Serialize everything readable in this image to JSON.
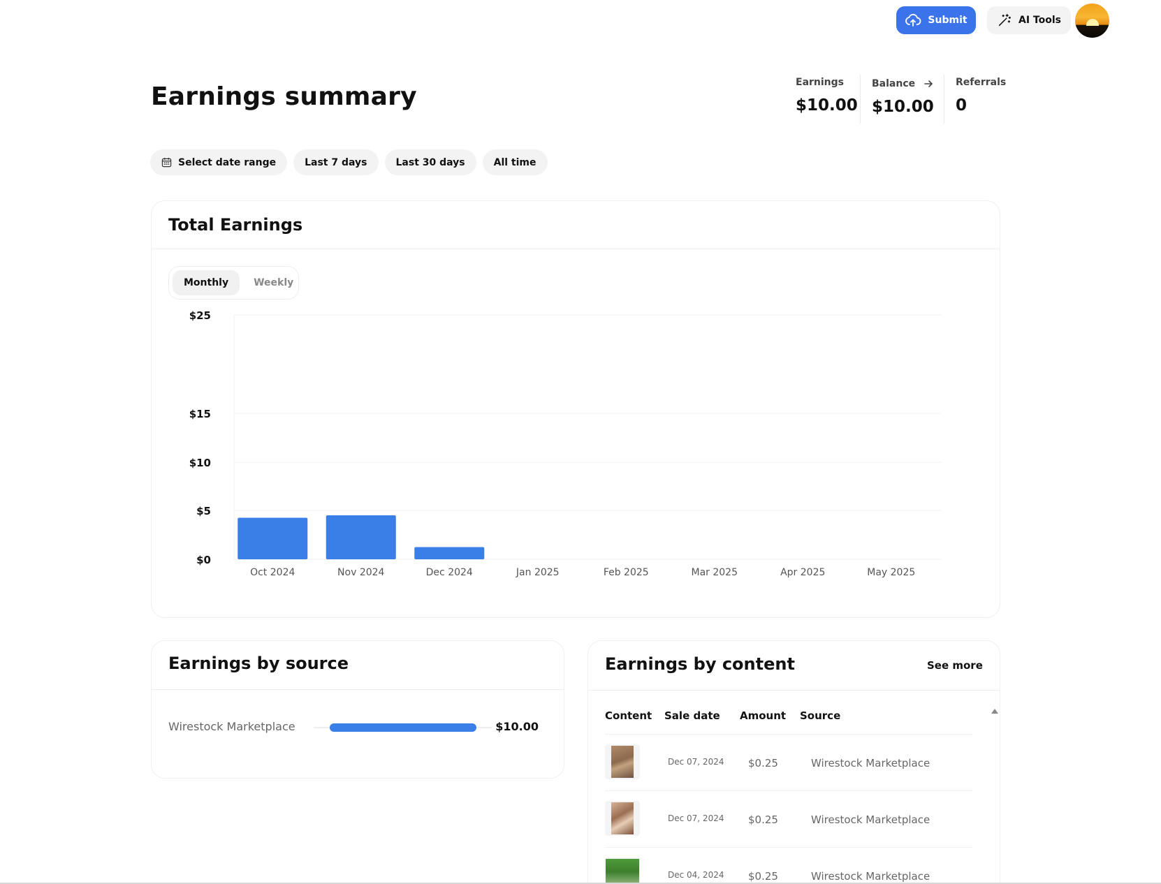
{
  "topbar": {
    "submit_label": "Submit",
    "ai_tools_label": "AI Tools"
  },
  "header": {
    "title": "Earnings summary",
    "stats": {
      "earnings_label": "Earnings",
      "earnings_value": "$10.00",
      "balance_label": "Balance",
      "balance_value": "$10.00",
      "referrals_label": "Referrals",
      "referrals_value": "0"
    }
  },
  "filters": [
    "Select date range",
    "Last 7 days",
    "Last 30 days",
    "All time"
  ],
  "total_earnings": {
    "title": "Total Earnings",
    "toggle": {
      "monthly": "Monthly",
      "weekly": "Weekly",
      "selected": "Monthly"
    }
  },
  "chart_data": {
    "type": "bar",
    "categories": [
      "Oct 2024",
      "Nov 2024",
      "Dec 2024",
      "Jan 2025",
      "Feb 2025",
      "Mar 2025",
      "Apr 2025",
      "May 2025"
    ],
    "values": [
      4.25,
      4.5,
      1.25,
      0,
      0,
      0,
      0,
      0
    ],
    "y_ticks": [
      0,
      5,
      10,
      15,
      25
    ],
    "y_tick_labels": [
      "$0",
      "$5",
      "$10",
      "$15",
      "$25"
    ],
    "ylim": [
      0,
      25
    ],
    "grid": true,
    "bar_color": "#3a7ee8"
  },
  "earnings_by_source": {
    "title": "Earnings by source",
    "rows": [
      {
        "name": "Wirestock Marketplace",
        "amount": "$10.00",
        "share": 1.0
      }
    ]
  },
  "earnings_by_content": {
    "title": "Earnings by content",
    "see_more": "See more",
    "columns": [
      "Content",
      "Sale date",
      "Amount",
      "Source"
    ],
    "rows": [
      {
        "date": "Dec 07, 2024",
        "amount": "$0.25",
        "source": "Wirestock Marketplace"
      },
      {
        "date": "Dec 07, 2024",
        "amount": "$0.25",
        "source": "Wirestock Marketplace"
      },
      {
        "date": "Dec 04, 2024",
        "amount": "$0.25",
        "source": "Wirestock Marketplace"
      }
    ]
  },
  "colors": {
    "accent": "#3a73ea",
    "bar": "#3a7ee8",
    "pill_bg": "#f3f3f3"
  },
  "icons": {
    "submit": "upload-cloud-icon",
    "ai_tools": "magic-wand-icon",
    "date_range": "calendar-icon",
    "balance": "arrow-right-icon"
  }
}
